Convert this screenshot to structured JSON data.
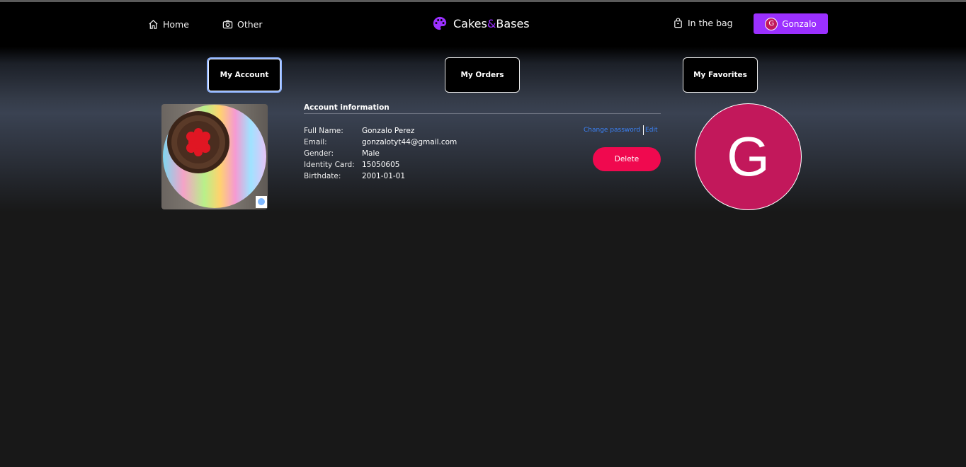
{
  "nav": {
    "home_label": "Home",
    "other_label": "Other",
    "brand_part1": "Cakes",
    "brand_amp": "&",
    "brand_part2": "Bases",
    "bag_label": "In the bag",
    "user_label": "Gonzalo",
    "user_initial": "G"
  },
  "tabs": {
    "account": "My Account",
    "orders": "My Orders",
    "favorites": "My Favorites"
  },
  "account": {
    "title": "Account information",
    "rows": [
      {
        "label": "Full Name:",
        "value": "Gonzalo Perez"
      },
      {
        "label": "Email:",
        "value": "gonzalotyt44@gmail.com"
      },
      {
        "label": "Gender:",
        "value": "Male"
      },
      {
        "label": "Identity Card:",
        "value": "15050605"
      },
      {
        "label": "Birthdate:",
        "value": "2001-01-01"
      }
    ],
    "change_password": "Change password",
    "edit": "Edit",
    "delete": "Delete"
  },
  "avatar": {
    "initial": "G"
  },
  "colors": {
    "accent": "#9b30ff",
    "avatar_bg": "#c2185b",
    "delete_bg": "#f0094f",
    "link": "#3b82f6"
  }
}
